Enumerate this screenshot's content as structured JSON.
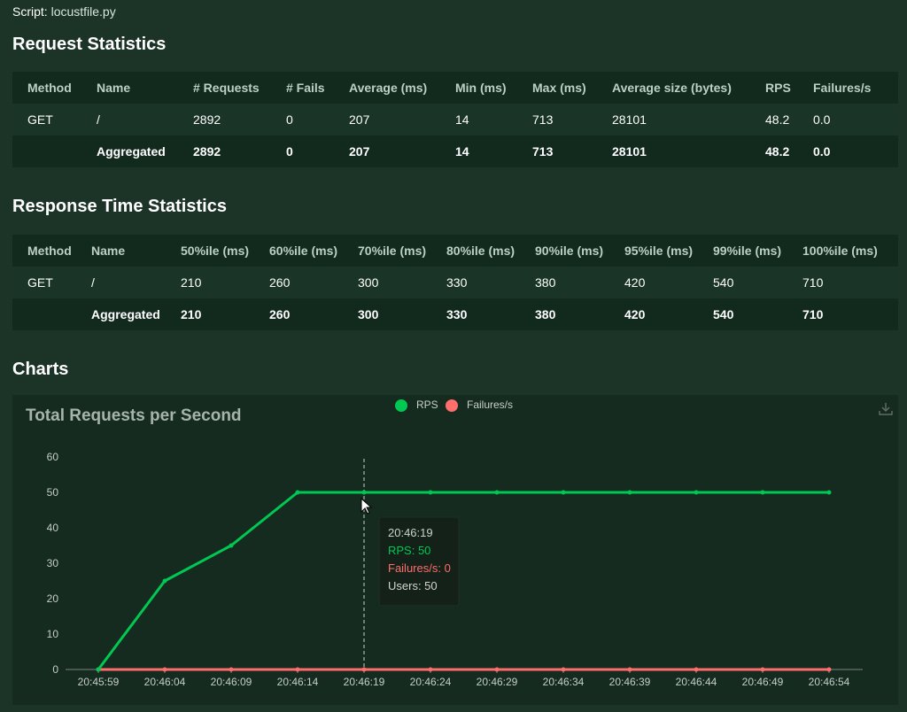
{
  "script": {
    "label": "Script:",
    "value": "locustfile.py"
  },
  "request_stats": {
    "title": "Request Statistics",
    "headers": [
      "Method",
      "Name",
      "# Requests",
      "# Fails",
      "Average (ms)",
      "Min (ms)",
      "Max (ms)",
      "Average size (bytes)",
      "RPS",
      "Failures/s"
    ],
    "rows": [
      [
        "GET",
        "/",
        "2892",
        "0",
        "207",
        "14",
        "713",
        "28101",
        "48.2",
        "0.0"
      ],
      [
        "",
        "Aggregated",
        "2892",
        "0",
        "207",
        "14",
        "713",
        "28101",
        "48.2",
        "0.0"
      ]
    ]
  },
  "response_stats": {
    "title": "Response Time Statistics",
    "headers": [
      "Method",
      "Name",
      "50%ile (ms)",
      "60%ile (ms)",
      "70%ile (ms)",
      "80%ile (ms)",
      "90%ile (ms)",
      "95%ile (ms)",
      "99%ile (ms)",
      "100%ile (ms)"
    ],
    "rows": [
      [
        "GET",
        "/",
        "210",
        "260",
        "300",
        "330",
        "380",
        "420",
        "540",
        "710"
      ],
      [
        "",
        "Aggregated",
        "210",
        "260",
        "300",
        "330",
        "380",
        "420",
        "540",
        "710"
      ]
    ]
  },
  "charts_title": "Charts",
  "colors": {
    "rps": "#00c853",
    "failures": "#ff6d6d",
    "users": "#d4d4d4"
  },
  "chart_data": {
    "type": "line",
    "title": "Total Requests per Second",
    "categories": [
      "20:45:59",
      "20:46:04",
      "20:46:09",
      "20:46:14",
      "20:46:19",
      "20:46:24",
      "20:46:29",
      "20:46:34",
      "20:46:39",
      "20:46:44",
      "20:46:49",
      "20:46:54"
    ],
    "series": [
      {
        "name": "RPS",
        "values": [
          0,
          25,
          35,
          50,
          50,
          50,
          50,
          50,
          50,
          50,
          50,
          50
        ]
      },
      {
        "name": "Failures/s",
        "values": [
          0,
          0,
          0,
          0,
          0,
          0,
          0,
          0,
          0,
          0,
          0,
          0
        ]
      }
    ],
    "ylim": [
      0,
      60
    ],
    "yticks": [
      0,
      10,
      20,
      30,
      40,
      50,
      60
    ],
    "legend_position": "top-center",
    "grid": false,
    "tooltip": {
      "index": 4,
      "time": "20:46:19",
      "lines": [
        {
          "text": "RPS: 50",
          "color_key": "rps"
        },
        {
          "text": "Failures/s: 0",
          "color_key": "failures"
        },
        {
          "text": "Users: 50",
          "color_key": "users"
        }
      ]
    }
  },
  "icons": {
    "download": "download-icon"
  }
}
